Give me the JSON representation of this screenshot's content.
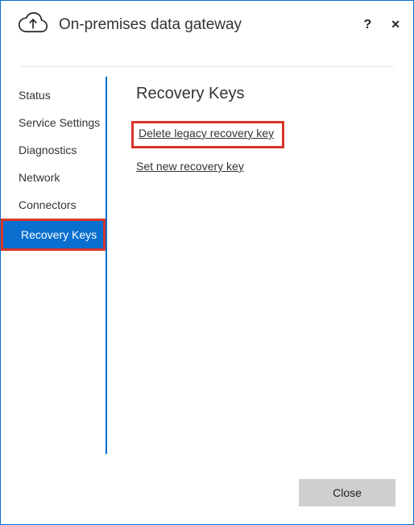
{
  "header": {
    "title": "On-premises data gateway",
    "help_tooltip": "?",
    "close_tooltip": "✕"
  },
  "sidebar": {
    "items": [
      {
        "label": "Status",
        "selected": false
      },
      {
        "label": "Service Settings",
        "selected": false
      },
      {
        "label": "Diagnostics",
        "selected": false
      },
      {
        "label": "Network",
        "selected": false
      },
      {
        "label": "Connectors",
        "selected": false
      },
      {
        "label": "Recovery Keys",
        "selected": true
      }
    ]
  },
  "content": {
    "heading": "Recovery Keys",
    "delete_link": "Delete legacy recovery key",
    "set_new_link": "Set new recovery key"
  },
  "footer": {
    "close_label": "Close"
  }
}
